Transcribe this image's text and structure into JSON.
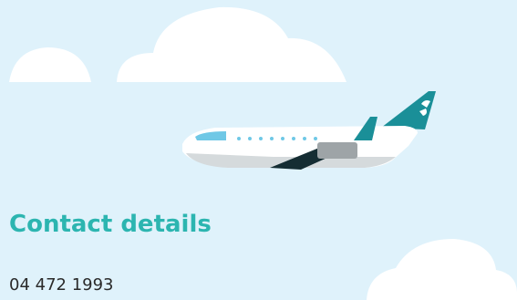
{
  "contact": {
    "heading": "Contact details",
    "phone": "04 472 1993"
  },
  "colors": {
    "background": "#dff2fb",
    "cloud": "#ffffff",
    "heading": "#2cb5b0",
    "text": "#2a2a2a",
    "tail": "#1a8f98"
  },
  "icons": [
    "cloud-icon",
    "airplane-icon",
    "airline-logo-icon"
  ]
}
